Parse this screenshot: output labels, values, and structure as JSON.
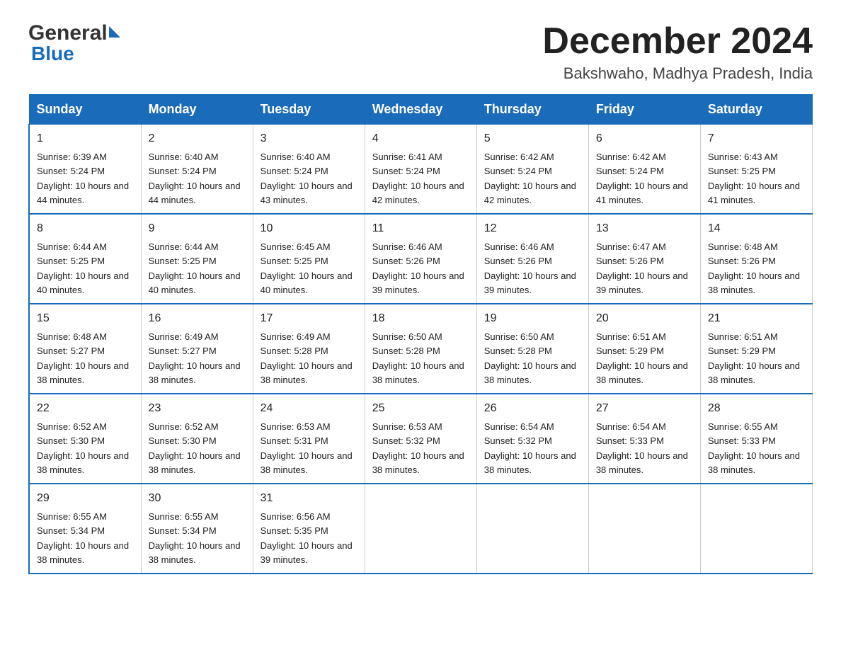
{
  "header": {
    "logo_general": "General",
    "logo_blue": "Blue",
    "title": "December 2024",
    "subtitle": "Bakshwaho, Madhya Pradesh, India"
  },
  "days_of_week": [
    "Sunday",
    "Monday",
    "Tuesday",
    "Wednesday",
    "Thursday",
    "Friday",
    "Saturday"
  ],
  "weeks": [
    [
      {
        "day": "1",
        "sunrise": "6:39 AM",
        "sunset": "5:24 PM",
        "daylight": "10 hours and 44 minutes."
      },
      {
        "day": "2",
        "sunrise": "6:40 AM",
        "sunset": "5:24 PM",
        "daylight": "10 hours and 44 minutes."
      },
      {
        "day": "3",
        "sunrise": "6:40 AM",
        "sunset": "5:24 PM",
        "daylight": "10 hours and 43 minutes."
      },
      {
        "day": "4",
        "sunrise": "6:41 AM",
        "sunset": "5:24 PM",
        "daylight": "10 hours and 42 minutes."
      },
      {
        "day": "5",
        "sunrise": "6:42 AM",
        "sunset": "5:24 PM",
        "daylight": "10 hours and 42 minutes."
      },
      {
        "day": "6",
        "sunrise": "6:42 AM",
        "sunset": "5:24 PM",
        "daylight": "10 hours and 41 minutes."
      },
      {
        "day": "7",
        "sunrise": "6:43 AM",
        "sunset": "5:25 PM",
        "daylight": "10 hours and 41 minutes."
      }
    ],
    [
      {
        "day": "8",
        "sunrise": "6:44 AM",
        "sunset": "5:25 PM",
        "daylight": "10 hours and 40 minutes."
      },
      {
        "day": "9",
        "sunrise": "6:44 AM",
        "sunset": "5:25 PM",
        "daylight": "10 hours and 40 minutes."
      },
      {
        "day": "10",
        "sunrise": "6:45 AM",
        "sunset": "5:25 PM",
        "daylight": "10 hours and 40 minutes."
      },
      {
        "day": "11",
        "sunrise": "6:46 AM",
        "sunset": "5:26 PM",
        "daylight": "10 hours and 39 minutes."
      },
      {
        "day": "12",
        "sunrise": "6:46 AM",
        "sunset": "5:26 PM",
        "daylight": "10 hours and 39 minutes."
      },
      {
        "day": "13",
        "sunrise": "6:47 AM",
        "sunset": "5:26 PM",
        "daylight": "10 hours and 39 minutes."
      },
      {
        "day": "14",
        "sunrise": "6:48 AM",
        "sunset": "5:26 PM",
        "daylight": "10 hours and 38 minutes."
      }
    ],
    [
      {
        "day": "15",
        "sunrise": "6:48 AM",
        "sunset": "5:27 PM",
        "daylight": "10 hours and 38 minutes."
      },
      {
        "day": "16",
        "sunrise": "6:49 AM",
        "sunset": "5:27 PM",
        "daylight": "10 hours and 38 minutes."
      },
      {
        "day": "17",
        "sunrise": "6:49 AM",
        "sunset": "5:28 PM",
        "daylight": "10 hours and 38 minutes."
      },
      {
        "day": "18",
        "sunrise": "6:50 AM",
        "sunset": "5:28 PM",
        "daylight": "10 hours and 38 minutes."
      },
      {
        "day": "19",
        "sunrise": "6:50 AM",
        "sunset": "5:28 PM",
        "daylight": "10 hours and 38 minutes."
      },
      {
        "day": "20",
        "sunrise": "6:51 AM",
        "sunset": "5:29 PM",
        "daylight": "10 hours and 38 minutes."
      },
      {
        "day": "21",
        "sunrise": "6:51 AM",
        "sunset": "5:29 PM",
        "daylight": "10 hours and 38 minutes."
      }
    ],
    [
      {
        "day": "22",
        "sunrise": "6:52 AM",
        "sunset": "5:30 PM",
        "daylight": "10 hours and 38 minutes."
      },
      {
        "day": "23",
        "sunrise": "6:52 AM",
        "sunset": "5:30 PM",
        "daylight": "10 hours and 38 minutes."
      },
      {
        "day": "24",
        "sunrise": "6:53 AM",
        "sunset": "5:31 PM",
        "daylight": "10 hours and 38 minutes."
      },
      {
        "day": "25",
        "sunrise": "6:53 AM",
        "sunset": "5:32 PM",
        "daylight": "10 hours and 38 minutes."
      },
      {
        "day": "26",
        "sunrise": "6:54 AM",
        "sunset": "5:32 PM",
        "daylight": "10 hours and 38 minutes."
      },
      {
        "day": "27",
        "sunrise": "6:54 AM",
        "sunset": "5:33 PM",
        "daylight": "10 hours and 38 minutes."
      },
      {
        "day": "28",
        "sunrise": "6:55 AM",
        "sunset": "5:33 PM",
        "daylight": "10 hours and 38 minutes."
      }
    ],
    [
      {
        "day": "29",
        "sunrise": "6:55 AM",
        "sunset": "5:34 PM",
        "daylight": "10 hours and 38 minutes."
      },
      {
        "day": "30",
        "sunrise": "6:55 AM",
        "sunset": "5:34 PM",
        "daylight": "10 hours and 38 minutes."
      },
      {
        "day": "31",
        "sunrise": "6:56 AM",
        "sunset": "5:35 PM",
        "daylight": "10 hours and 39 minutes."
      },
      null,
      null,
      null,
      null
    ]
  ],
  "labels": {
    "sunrise": "Sunrise:",
    "sunset": "Sunset:",
    "daylight": "Daylight:"
  }
}
